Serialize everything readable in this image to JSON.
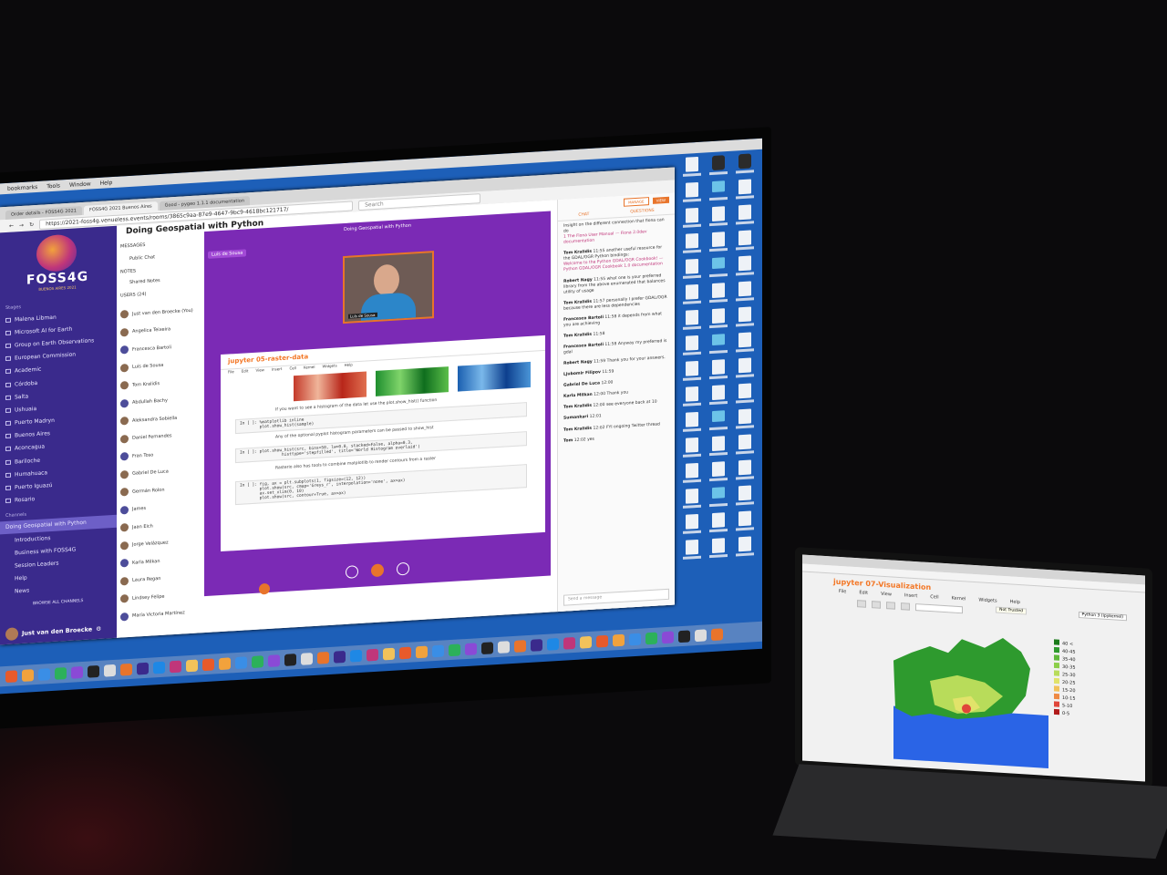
{
  "menubar": {
    "items": [
      "bookmarks",
      "Tools",
      "Window",
      "Help"
    ]
  },
  "browser": {
    "tabs": [
      "Order details - FOSS4G 2021",
      "FOSS4G 2021 Buenos Aires",
      "Good - pygeo 1.1.1 documentation"
    ],
    "url": "https://2021-foss4g.venueless.events/rooms/3865c9aa-87e9-4647-9bc9-4618bc121717/",
    "search_placeholder": "Search"
  },
  "sidebar": {
    "logo_text": "FOSS4G",
    "logo_sub": "BUENOS AIRES 2021",
    "stages_heading": "Stages",
    "stages": [
      "Malena Libman",
      "Microsoft AI for Earth",
      "Group on Earth Observations",
      "European Commission",
      "Academic",
      "Córdoba",
      "Salta",
      "Ushuaia",
      "Puerto Madryn",
      "Buenos Aires",
      "Aconcagua",
      "Bariloche",
      "Humahuaca",
      "Puerto Iguazú",
      "Rosario"
    ],
    "channels_heading": "Channels",
    "active_channel": "Doing Geospatial with Python",
    "channels": [
      "Introductions",
      "Business with FOSS4G",
      "Session Leaders",
      "Help",
      "News"
    ],
    "browse_label": "BROWSE ALL CHANNELS",
    "user_name": "Just van den Broecke"
  },
  "room": {
    "title": "Doing Geospatial with Python",
    "messages_label": "MESSAGES",
    "public_chat": "Public Chat",
    "notes_label": "NOTES",
    "shared_notes": "Shared Notes",
    "users_label": "USERS (24)",
    "users": [
      "Just van den Broecke (You)",
      "Angelica Teixeira",
      "Francesca Bartoli",
      "Luís de Sousa",
      "Tom Kralidis",
      "Abdullah Bachy",
      "Aleksandra Sobiella",
      "Daniel Fernandes",
      "Fran Toso",
      "Gabriel De Luca",
      "Germán Rolon",
      "James",
      "Jaan Eich",
      "Jorge Velázquez",
      "Karla Milkan",
      "Laura Regan",
      "Lindsey Felipe",
      "María Victoria Martínez"
    ]
  },
  "stage": {
    "title": "Doing Geospatial with Python",
    "speaker": "Luís de Sousa",
    "notebook_title": "jupyter 05-raster-data",
    "notebook_menu": [
      "File",
      "Edit",
      "View",
      "Insert",
      "Cell",
      "Kernel",
      "Widgets",
      "Help"
    ],
    "text1": "If you want to see a histogram of the data let use the plot.show_hist() function",
    "code1": "In [ ]: %matplotlib inline\n        plot.show_hist(sample)",
    "text2": "Any of the optional pyplot histogram parameters can be passed to show_hist",
    "code2": "In [ ]: plot.show_hist(src, bins=50, lw=0.0, stacked=False, alpha=0.3,\n                 histtype='stepfilled', title='World Histogram overlaid')",
    "text3": "Rasterio also has tools to combine matplotlib to render contours from a raster",
    "code3": "In [ ]: fig, ax = plt.subplots(1, figsize=(12, 12))\n        plot.show(src, cmap='Greys_r', interpolation='none', ax=ax)\n        ax.set_xlim(0, 10)\n        plot.show(src, contour=True, ax=ax)"
  },
  "chat": {
    "manage": "MANAGE",
    "view": "VIEW",
    "tabs": [
      "CHAT",
      "QUESTIONS"
    ],
    "messages": [
      {
        "author": "",
        "time": "",
        "text": "Insight on the different connection that fiona can do",
        "link": "1 The Fiona User Manual — Fiona 2.0dev documentation"
      },
      {
        "author": "Tom Kralidis",
        "time": "11:55",
        "text": "another useful resource for the GDAL/OGR Python bindings:",
        "link": "Welcome to the Python GDAL/OGR Cookbook! — Python GDAL/OGR Cookbook 1.0 documentation"
      },
      {
        "author": "Robert Nagy",
        "time": "11:55",
        "text": "what one is your preferred library from the above enumerated that balances utility of usage"
      },
      {
        "author": "Tom Kralidis",
        "time": "11:57",
        "text": "personally I prefer GDAL/OGR because there are less dependencies"
      },
      {
        "author": "Francesco Bartoli",
        "time": "11:58",
        "text": "it depends from what you are achieving"
      },
      {
        "author": "Tom Kralidis",
        "time": "11:58",
        "text": ""
      },
      {
        "author": "Francesco Bartoli",
        "time": "11:58",
        "text": "Anyway my preferred is gdal"
      },
      {
        "author": "Robert Nagy",
        "time": "11:59",
        "text": "Thank you for your answers."
      },
      {
        "author": "Ljubomir Filipov",
        "time": "11:59",
        "text": ""
      },
      {
        "author": "Gabriel De Luca",
        "time": "12:00",
        "text": ""
      },
      {
        "author": "Karla Milkan",
        "time": "12:00",
        "text": "Thank you"
      },
      {
        "author": "Tom Kralidis",
        "time": "12:00",
        "text": "see everyone back at 10"
      },
      {
        "author": "Sumankari",
        "time": "12:01",
        "text": ""
      },
      {
        "author": "Tom Kralidis",
        "time": "12:02",
        "text": "FYI ongoing Twitter thread"
      },
      {
        "author": "Tom",
        "time": "12:02",
        "text": "yes"
      }
    ],
    "input_placeholder": "Send a message"
  },
  "laptop": {
    "notebook_title": "jupyter 07-Visualization",
    "menu": [
      "File",
      "Edit",
      "View",
      "Insert",
      "Cell",
      "Kernel",
      "Widgets",
      "Help"
    ],
    "notice": "Not Trusted",
    "kernel": "Python 3 (ipykernel)",
    "legend": [
      "40 <",
      "40-45",
      "35-40",
      "30-35",
      "25-30",
      "20-25",
      "15-20",
      "10-15",
      "5-10",
      "0-5"
    ],
    "legend_colors": [
      "#1a7a1a",
      "#2e9a2e",
      "#5fb83a",
      "#8ccf4a",
      "#b8dc5a",
      "#e1e36a",
      "#f2c25a",
      "#ee8a44",
      "#e0463a",
      "#b01a1a"
    ]
  },
  "colors": {
    "accent": "#e8742b",
    "brand": "#3a2a8c",
    "stage": "#7b2ab5",
    "desktop": "#1d5fb8"
  }
}
